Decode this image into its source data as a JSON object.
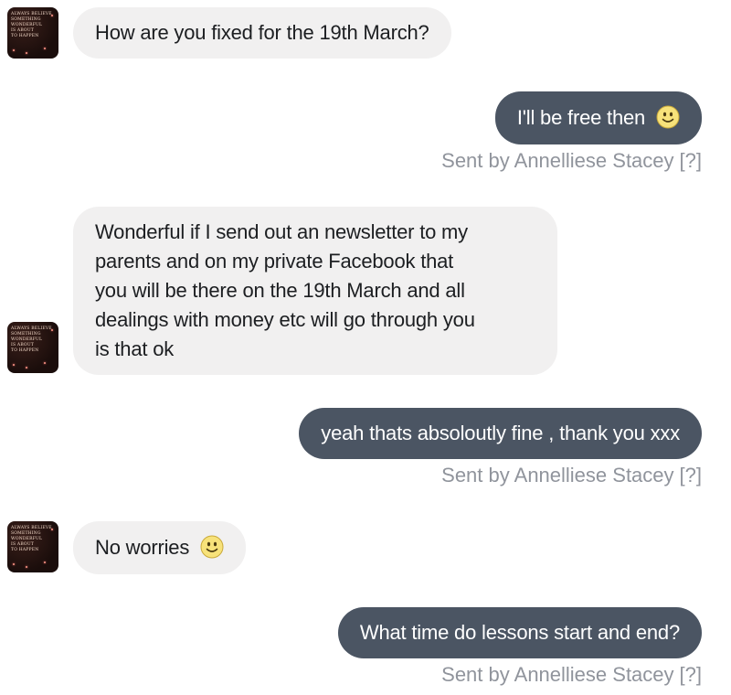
{
  "conversation": {
    "messages": [
      {
        "direction": "incoming",
        "text": "How are you fixed for the 19th March?"
      },
      {
        "direction": "outgoing",
        "text": "I'll be free then",
        "emoji": "smiley-face-icon",
        "sent_by": "Sent by Annelliese Stacey",
        "help": "[?]"
      },
      {
        "direction": "incoming",
        "lines": [
          "Wonderful if I send out an newsletter to my",
          "parents and on my private Facebook that",
          "you will be there on the 19th March and all",
          "dealings with money etc will go through you",
          "is that ok"
        ]
      },
      {
        "direction": "outgoing",
        "text": "yeah thats absoloutly fine , thank you xxx",
        "sent_by": "Sent by Annelliese Stacey",
        "help": "[?]"
      },
      {
        "direction": "incoming",
        "text": "No worries",
        "emoji": "smiley-face-icon"
      },
      {
        "direction": "outgoing",
        "text": "What time do lessons start and end?",
        "sent_by": "Sent by Annelliese Stacey",
        "help": "[?]"
      }
    ],
    "avatar_lines": [
      "Always believe",
      "something",
      "wonderful",
      "is about",
      "to happen"
    ]
  },
  "colors": {
    "incoming_bubble": "#f1f0f0",
    "outgoing_bubble": "#4b5563",
    "sent_by_text": "#90949c"
  }
}
